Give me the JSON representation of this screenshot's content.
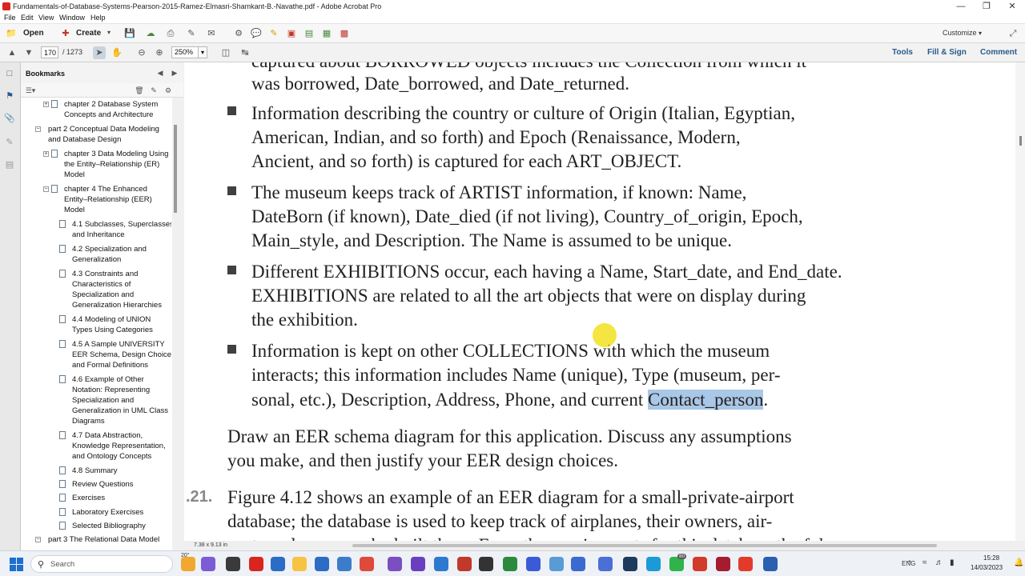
{
  "window": {
    "title": "Fundamentals-of-Database-Systems-Pearson-2015-Ramez-Elmasri-Shamkant-B.-Navathe.pdf - Adobe Acrobat Pro",
    "minimize": "—",
    "maximize": "❐",
    "close": "✕"
  },
  "menubar": {
    "file": "File",
    "edit": "Edit",
    "view": "View",
    "window": "Window",
    "help": "Help"
  },
  "toolbar": {
    "open_label": "Open",
    "create_label": "Create",
    "customize_label": "Customize",
    "page_current": "170",
    "page_total": "/ 1273",
    "zoom": "250%",
    "tools_link": "Tools",
    "fill_sign_link": "Fill & Sign",
    "comment_link": "Comment"
  },
  "bookmarks": {
    "title": "Bookmarks",
    "items": [
      {
        "label": "chapter 2 Database System Concepts and Architecture",
        "lines": [
          "chapter 2 Database System",
          "Concepts and Architecture"
        ]
      },
      {
        "label": "part 2 Conceptual Data Modeling and Database Design",
        "lines": [
          "part 2 Conceptual Data Modeling",
          "and Database Design"
        ]
      },
      {
        "label": "chapter 3 Data Modeling Using the Entity–Relationship (ER) Model",
        "lines": [
          "chapter 3 Data Modeling Using",
          "the Entity–Relationship (ER)",
          "Model"
        ]
      },
      {
        "label": "chapter 4 The Enhanced Entity–Relationship (EER) Model",
        "lines": [
          "chapter 4 The Enhanced",
          "Entity–Relationship (EER)",
          "Model"
        ]
      },
      {
        "label": "4.1 Subclasses, Superclasses, and Inheritance",
        "lines": [
          "4.1 Subclasses, Superclasses,",
          "and Inheritance"
        ]
      },
      {
        "label": "4.2 Specialization and Generalization",
        "lines": [
          "4.2 Specialization and",
          "Generalization"
        ]
      },
      {
        "label": "4.3 Constraints and Characteristics of Specialization and Generalization Hierarchies",
        "lines": [
          "4.3 Constraints and",
          "Characteristics of",
          "Specialization and",
          "Generalization Hierarchies"
        ]
      },
      {
        "label": "4.4 Modeling of UNION Types Using Categories",
        "lines": [
          "4.4 Modeling of UNION",
          "Types Using Categories"
        ]
      },
      {
        "label": "4.5 A Sample UNIVERSITY EER Schema, Design Choices, and Formal Definitions",
        "lines": [
          "4.5 A Sample UNIVERSITY",
          "EER Schema, Design Choices,",
          "and Formal Definitions"
        ]
      },
      {
        "label": "4.6 Example of Other Notation: Representing Specialization and Generalization in UML Class Diagrams",
        "lines": [
          "4.6 Example of Other",
          "Notation: Representing",
          "Specialization and",
          "Generalization in UML Class",
          "Diagrams"
        ]
      },
      {
        "label": "4.7 Data Abstraction, Knowledge Representation, and Ontology Concepts",
        "lines": [
          "4.7 Data Abstraction,",
          "Knowledge Representation,",
          "and Ontology Concepts"
        ]
      },
      {
        "label": "4.8 Summary",
        "lines": [
          "4.8 Summary"
        ]
      },
      {
        "label": "Review Questions",
        "lines": [
          "Review Questions"
        ]
      },
      {
        "label": "Exercises",
        "lines": [
          "Exercises"
        ]
      },
      {
        "label": "Laboratory Exercises",
        "lines": [
          "Laboratory Exercises"
        ]
      },
      {
        "label": "Selected Bibliography",
        "lines": [
          "Selected Bibliography"
        ]
      },
      {
        "label": "part 3 The Relational Data Model",
        "lines": [
          "part 3 The Relational Data Model"
        ]
      }
    ]
  },
  "document": {
    "lines": [
      "captured about BORROWED objects includes the Collection from which it",
      "was borrowed, Date_borrowed, and Date_returned.",
      "Information describing the country or culture of Origin (Italian, Egyptian,",
      "American, Indian, and so forth) and Epoch (Renaissance, Modern,",
      "Ancient, and so forth) is captured for each ART_OBJECT.",
      "The museum keeps track of ARTIST information, if known: Name,",
      "DateBorn (if known), Date_died (if not living), Country_of_origin, Epoch,",
      "Main_style, and Description. The Name is assumed to be unique.",
      "Different EXHIBITIONS occur, each having a Name, Start_date, and End_date.",
      "EXHIBITIONS are related to all the art objects that were on display during",
      "the exhibition.",
      "Information is kept on other COLLECTIONS with which the museum",
      "interacts; this information includes Name (unique), Type (museum, per-",
      "sonal, etc.), Description, Address, Phone, and current ",
      "Contact_person",
      ".",
      "Draw an EER schema diagram for this application. Discuss any assumptions",
      "you make, and then justify your EER design choices.",
      ".21.",
      "Figure 4.12 shows an example of an EER diagram for a small-private-airport",
      "database; the database is used to keep track of airplanes, their owners, air-",
      "ports and owners who built them. From the requirements for this database the fol-"
    ]
  },
  "status": {
    "page_size": "7.38 x 9.13 in"
  },
  "taskbar": {
    "search_placeholder": "Search",
    "weather": "20°",
    "lang": "ENG",
    "time": "15:28",
    "date": "14/03/2023",
    "badge_count": "80"
  },
  "colors": {
    "highlight": "#a9c7e6",
    "accent": "#2a5a8c"
  }
}
